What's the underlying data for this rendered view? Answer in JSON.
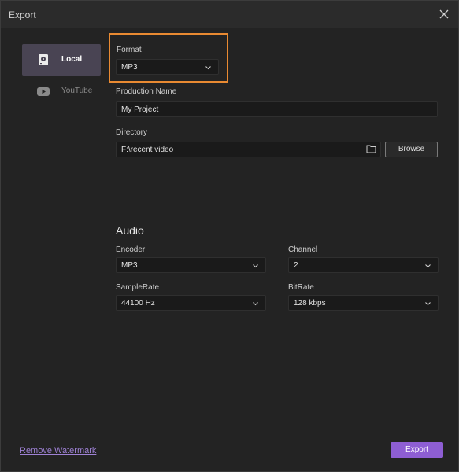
{
  "window": {
    "title": "Export"
  },
  "sidebar": {
    "items": [
      {
        "label": "Local",
        "icon": "local-drive-icon",
        "active": true
      },
      {
        "label": "YouTube",
        "icon": "youtube-icon",
        "active": false
      }
    ]
  },
  "format": {
    "label": "Format",
    "value": "MP3"
  },
  "production_name": {
    "label": "Production Name",
    "value": "My Project"
  },
  "directory": {
    "label": "Directory",
    "value": "F:\\recent video",
    "browse_label": "Browse"
  },
  "audio": {
    "title": "Audio",
    "encoder": {
      "label": "Encoder",
      "value": "MP3"
    },
    "channel": {
      "label": "Channel",
      "value": "2"
    },
    "sample_rate": {
      "label": "SampleRate",
      "value": "44100 Hz"
    },
    "bit_rate": {
      "label": "BitRate",
      "value": "128 kbps"
    }
  },
  "footer": {
    "watermark_link": "Remove Watermark",
    "export_label": "Export"
  },
  "colors": {
    "accent": "#8e5ed3",
    "highlight": "#e98a32",
    "link": "#9f82d6",
    "background": "#232323"
  }
}
